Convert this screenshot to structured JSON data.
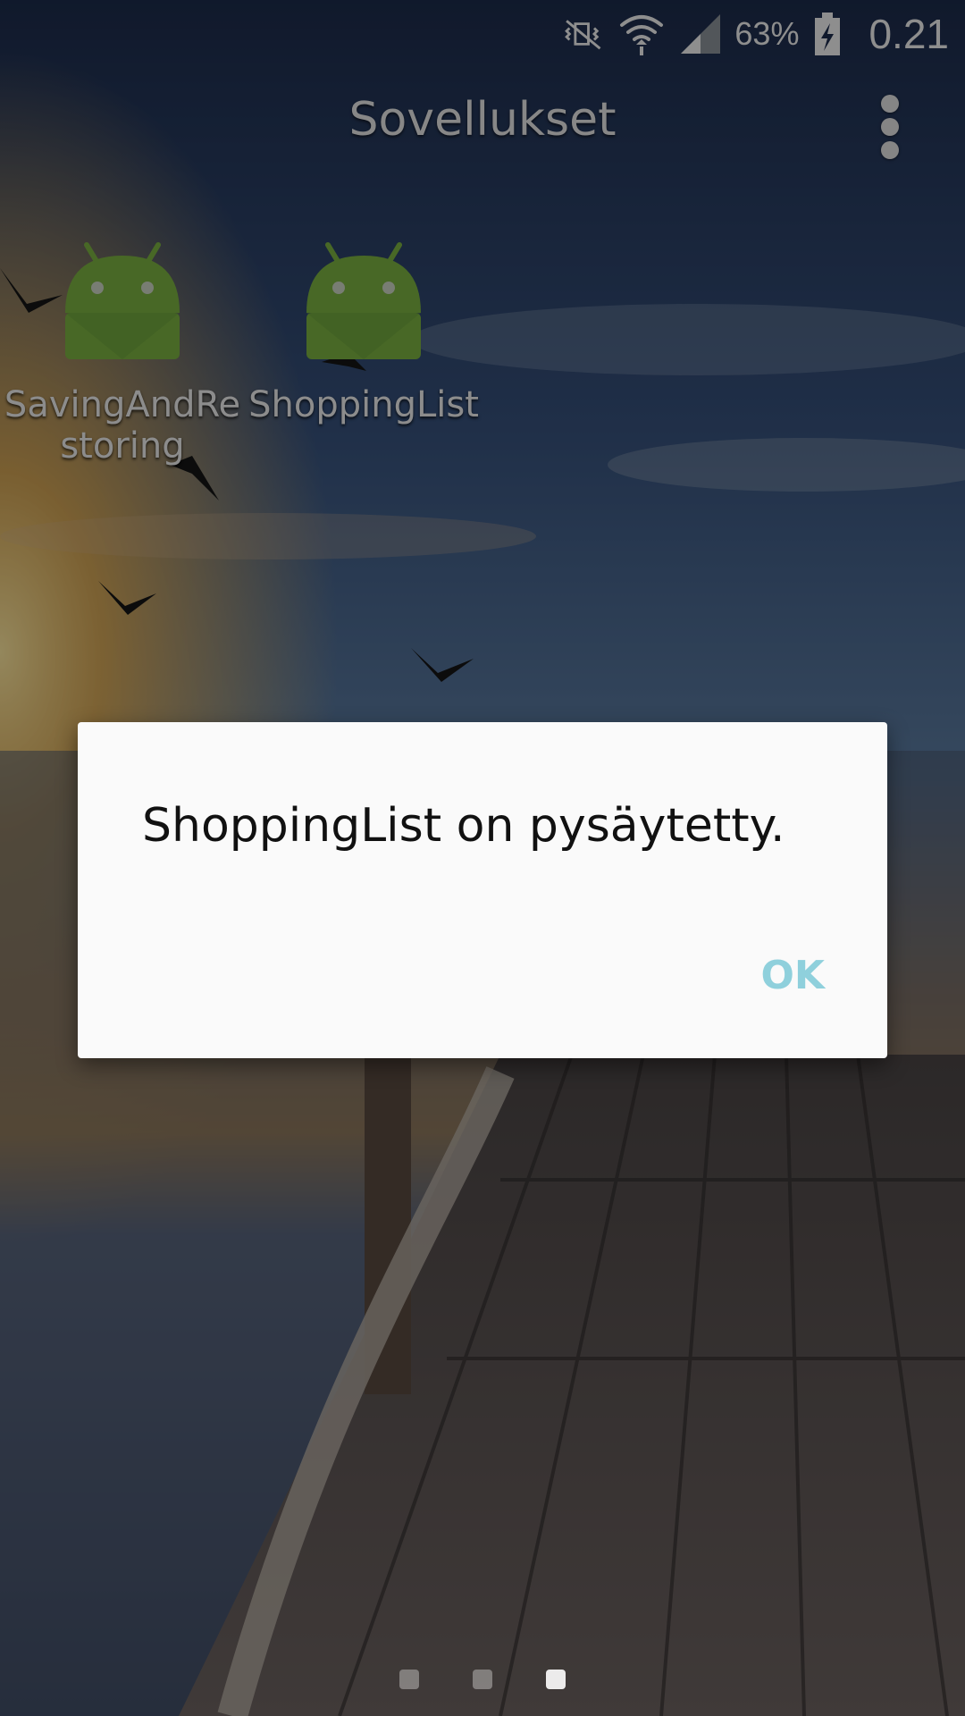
{
  "status_bar": {
    "icons": [
      "mute-vibrate-icon",
      "wifi-icon",
      "signal-icon",
      "battery-charging-icon"
    ],
    "battery_percent": "63%",
    "clock": "0.21"
  },
  "app_bar": {
    "title": "Sovellukset",
    "menu_icon": "overflow-menu-icon"
  },
  "apps": [
    {
      "label": "SavingAndRe storing",
      "icon": "android-icon"
    },
    {
      "label": "ShoppingList",
      "icon": "android-icon"
    }
  ],
  "dialog": {
    "message": "ShoppingList on pysäytetty.",
    "ok_label": "OK"
  },
  "page_indicator": {
    "pages": 3,
    "active_index": 2
  },
  "colors": {
    "android_green": "#7cb342",
    "ok_button": "#8fd0dc",
    "dialog_bg": "#fafafa"
  }
}
